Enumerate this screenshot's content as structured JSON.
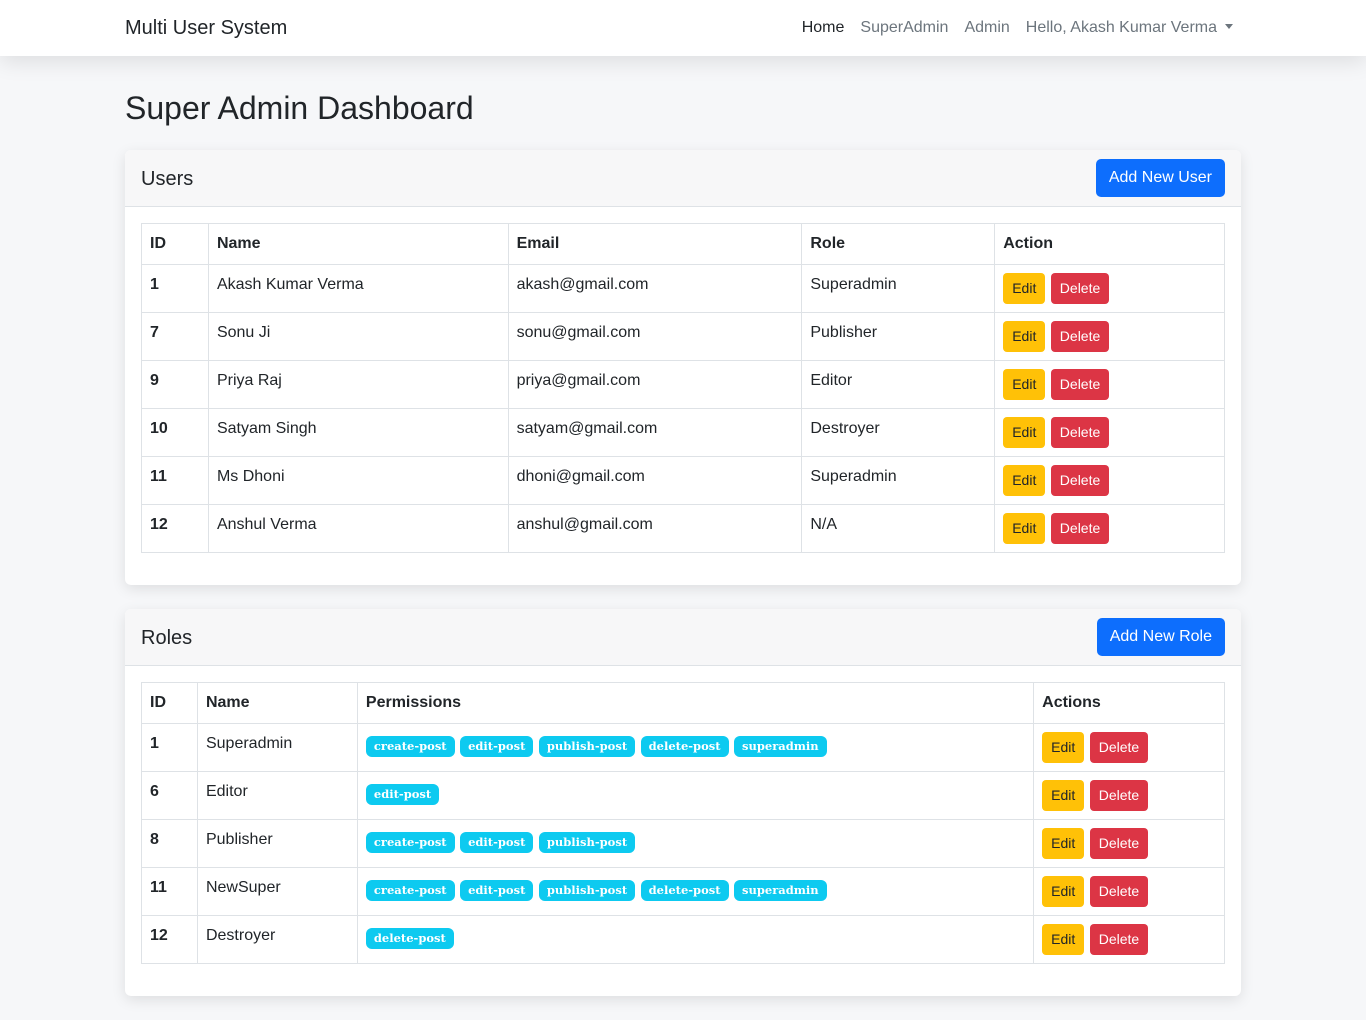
{
  "navbar": {
    "brand": "Multi User System",
    "links": [
      "Home",
      "SuperAdmin",
      "Admin"
    ],
    "user_menu": "Hello, Akash Kumar Verma"
  },
  "page_title": "Super Admin Dashboard",
  "users": {
    "title": "Users",
    "add_label": "Add New User",
    "columns": [
      "ID",
      "Name",
      "Email",
      "Role",
      "Action"
    ],
    "rows": [
      {
        "id": "1",
        "name": "Akash Kumar Verma",
        "email": "akash@gmail.com",
        "role": "Superadmin"
      },
      {
        "id": "7",
        "name": "Sonu Ji",
        "email": "sonu@gmail.com",
        "role": "Publisher"
      },
      {
        "id": "9",
        "name": "Priya Raj",
        "email": "priya@gmail.com",
        "role": "Editor"
      },
      {
        "id": "10",
        "name": "Satyam Singh",
        "email": "satyam@gmail.com",
        "role": "Destroyer"
      },
      {
        "id": "11",
        "name": "Ms Dhoni",
        "email": "dhoni@gmail.com",
        "role": "Superadmin"
      },
      {
        "id": "12",
        "name": "Anshul Verma",
        "email": "anshul@gmail.com",
        "role": "N/A"
      }
    ],
    "edit_label": "Edit",
    "delete_label": "Delete"
  },
  "roles": {
    "title": "Roles",
    "add_label": "Add New Role",
    "columns": [
      "ID",
      "Name",
      "Permissions",
      "Actions"
    ],
    "rows": [
      {
        "id": "1",
        "name": "Superadmin",
        "permissions": [
          "create-post",
          "edit-post",
          "publish-post",
          "delete-post",
          "superadmin"
        ]
      },
      {
        "id": "6",
        "name": "Editor",
        "permissions": [
          "edit-post"
        ]
      },
      {
        "id": "8",
        "name": "Publisher",
        "permissions": [
          "create-post",
          "edit-post",
          "publish-post"
        ]
      },
      {
        "id": "11",
        "name": "NewSuper",
        "permissions": [
          "create-post",
          "edit-post",
          "publish-post",
          "delete-post",
          "superadmin"
        ]
      },
      {
        "id": "12",
        "name": "Destroyer",
        "permissions": [
          "delete-post"
        ]
      }
    ],
    "edit_label": "Edit",
    "delete_label": "Delete"
  },
  "colors": {
    "primary": "#0d6efd",
    "warning": "#ffc107",
    "danger": "#dc3545",
    "info": "#0dcaf0"
  }
}
